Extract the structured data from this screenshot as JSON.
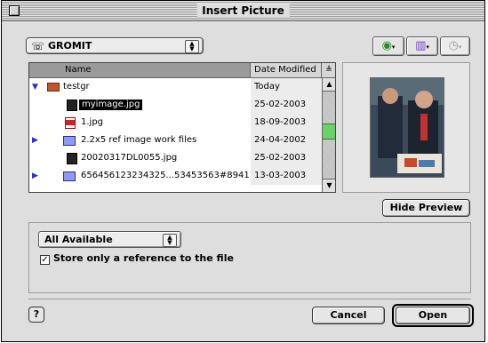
{
  "window": {
    "title": "Insert Picture"
  },
  "location": {
    "label": "GROMIT"
  },
  "file_list": {
    "columns": {
      "name": "Name",
      "date": "Date Modified"
    },
    "rows": [
      {
        "name": "testgr",
        "date": "Today",
        "kind": "folder-open"
      },
      {
        "name": "myimage.jpg",
        "date": "25-02-2003",
        "kind": "image",
        "selected": true
      },
      {
        "name": "1.jpg",
        "date": "18-09-2003",
        "kind": "jpg"
      },
      {
        "name": "2.2x5 ref image work files",
        "date": "24-04-2002",
        "kind": "folder"
      },
      {
        "name": "20020317DL0055.jpg",
        "date": "25-02-2003",
        "kind": "image"
      },
      {
        "name": "656456123234325...53453563#89411",
        "date": "13-03-2003",
        "kind": "folder"
      }
    ]
  },
  "buttons": {
    "hide_preview": "Hide Preview",
    "cancel": "Cancel",
    "open": "Open",
    "help": "?"
  },
  "options": {
    "filter": "All Available",
    "reference_checkbox_label": "Store only a reference to the file",
    "reference_checked": true
  }
}
